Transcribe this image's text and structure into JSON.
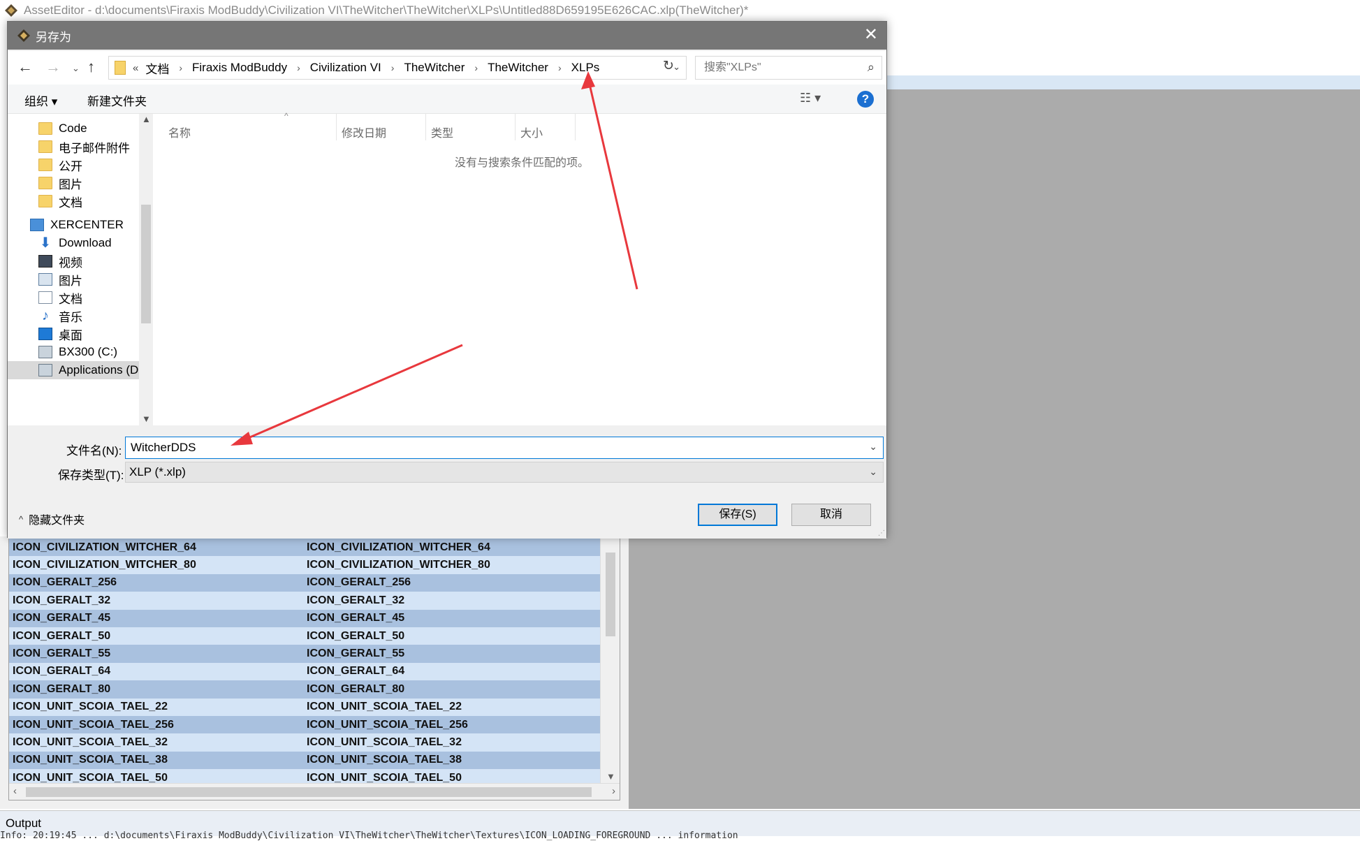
{
  "app": {
    "title": "AssetEditor - d:\\documents\\Firaxis ModBuddy\\Civilization VI\\TheWitcher\\TheWitcher\\XLPs\\Untitled88D659195E626CAC.xlp(TheWitcher)*"
  },
  "dialog": {
    "title": "另存为",
    "close_glyph": "✕",
    "nav": {
      "back": "←",
      "forward": "→",
      "history": "⌄",
      "up": "↑",
      "overflow": "«",
      "refresh": "↻"
    },
    "breadcrumbs": [
      "文档",
      "Firaxis ModBuddy",
      "Civilization VI",
      "TheWitcher",
      "TheWitcher",
      "XLPs"
    ],
    "search": {
      "placeholder": "搜索\"XLPs\""
    },
    "toolbar": {
      "organize": "组织 ▾",
      "new_folder": "新建文件夹",
      "view": "☷ ▾",
      "help": "?"
    },
    "nav_pane": [
      {
        "label": "Code",
        "icon": "folder-icon"
      },
      {
        "label": "电子邮件附件",
        "icon": "folder-icon"
      },
      {
        "label": "公开",
        "icon": "folder-icon"
      },
      {
        "label": "图片",
        "icon": "folder-icon"
      },
      {
        "label": "文档",
        "icon": "folder-icon"
      },
      {
        "label": "XERCENTER",
        "icon": "computer-icon"
      },
      {
        "label": "Download",
        "icon": "download-icon"
      },
      {
        "label": "视频",
        "icon": "video-icon"
      },
      {
        "label": "图片",
        "icon": "pictures-icon"
      },
      {
        "label": "文档",
        "icon": "documents-icon"
      },
      {
        "label": "音乐",
        "icon": "music-icon"
      },
      {
        "label": "桌面",
        "icon": "desktop-icon"
      },
      {
        "label": "BX300 (C:)",
        "icon": "drive-icon"
      },
      {
        "label": "Applications (D",
        "icon": "drive-icon"
      }
    ],
    "columns": [
      "名称",
      "修改日期",
      "类型",
      "大小"
    ],
    "empty_message": "没有与搜索条件匹配的项。",
    "filename": {
      "label": "文件名(N):",
      "value": "WitcherDDS"
    },
    "filetype": {
      "label": "保存类型(T):",
      "value": "XLP (*.xlp)"
    },
    "hide_folders": "隐藏文件夹",
    "save_button": "保存(S)",
    "cancel_button": "取消"
  },
  "grid": {
    "rows": [
      [
        "ICON_CIVILIZATION_WITCHER_64",
        "ICON_CIVILIZATION_WITCHER_64"
      ],
      [
        "ICON_CIVILIZATION_WITCHER_80",
        "ICON_CIVILIZATION_WITCHER_80"
      ],
      [
        "ICON_GERALT_256",
        "ICON_GERALT_256"
      ],
      [
        "ICON_GERALT_32",
        "ICON_GERALT_32"
      ],
      [
        "ICON_GERALT_45",
        "ICON_GERALT_45"
      ],
      [
        "ICON_GERALT_50",
        "ICON_GERALT_50"
      ],
      [
        "ICON_GERALT_55",
        "ICON_GERALT_55"
      ],
      [
        "ICON_GERALT_64",
        "ICON_GERALT_64"
      ],
      [
        "ICON_GERALT_80",
        "ICON_GERALT_80"
      ],
      [
        "ICON_UNIT_SCOIA_TAEL_22",
        "ICON_UNIT_SCOIA_TAEL_22"
      ],
      [
        "ICON_UNIT_SCOIA_TAEL_256",
        "ICON_UNIT_SCOIA_TAEL_256"
      ],
      [
        "ICON_UNIT_SCOIA_TAEL_32",
        "ICON_UNIT_SCOIA_TAEL_32"
      ],
      [
        "ICON_UNIT_SCOIA_TAEL_38",
        "ICON_UNIT_SCOIA_TAEL_38"
      ],
      [
        "ICON_UNIT_SCOIA_TAEL_50",
        "ICON_UNIT_SCOIA_TAEL_50"
      ]
    ]
  },
  "output": {
    "label": "Output",
    "line": "Info: 20:19:45 ... d:\\documents\\Firaxis ModBuddy\\Civilization VI\\TheWitcher\\TheWitcher\\Textures\\ICON_LOADING_FOREGROUND ... information"
  },
  "colors": {
    "annotation_arrow": "#e8383d",
    "accent": "#0078d7",
    "grid_row_dark": "#a9c1df",
    "grid_row_light": "#d4e4f6"
  }
}
